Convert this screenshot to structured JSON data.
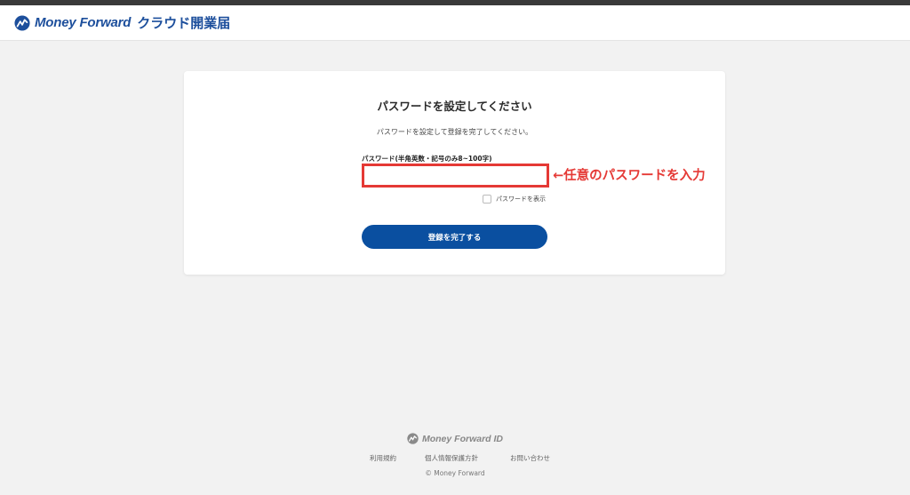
{
  "header": {
    "brand": "Money Forward",
    "product": "クラウド開業届"
  },
  "card": {
    "title": "パスワードを設定してください",
    "description": "パスワードを設定して登録を完了してください。",
    "field_label": "パスワード(半角英数・記号のみ8~100字)",
    "password_value": "",
    "show_password_label": "パスワードを表示",
    "show_password_checked": false,
    "submit_label": "登録を完了する"
  },
  "annotation": {
    "text": "←任意のパスワードを入力",
    "color": "#e53935"
  },
  "footer": {
    "brand": "Money Forward ID",
    "links": [
      "利用規約",
      "個人情報保護方針",
      "お問い合わせ"
    ],
    "copyright": "© Money Forward"
  },
  "colors": {
    "brand": "#1d4f9c",
    "primary_button": "#0a4fa0",
    "background": "#f2f2f2"
  },
  "icons": {
    "logo": "money-forward-logo-icon"
  }
}
